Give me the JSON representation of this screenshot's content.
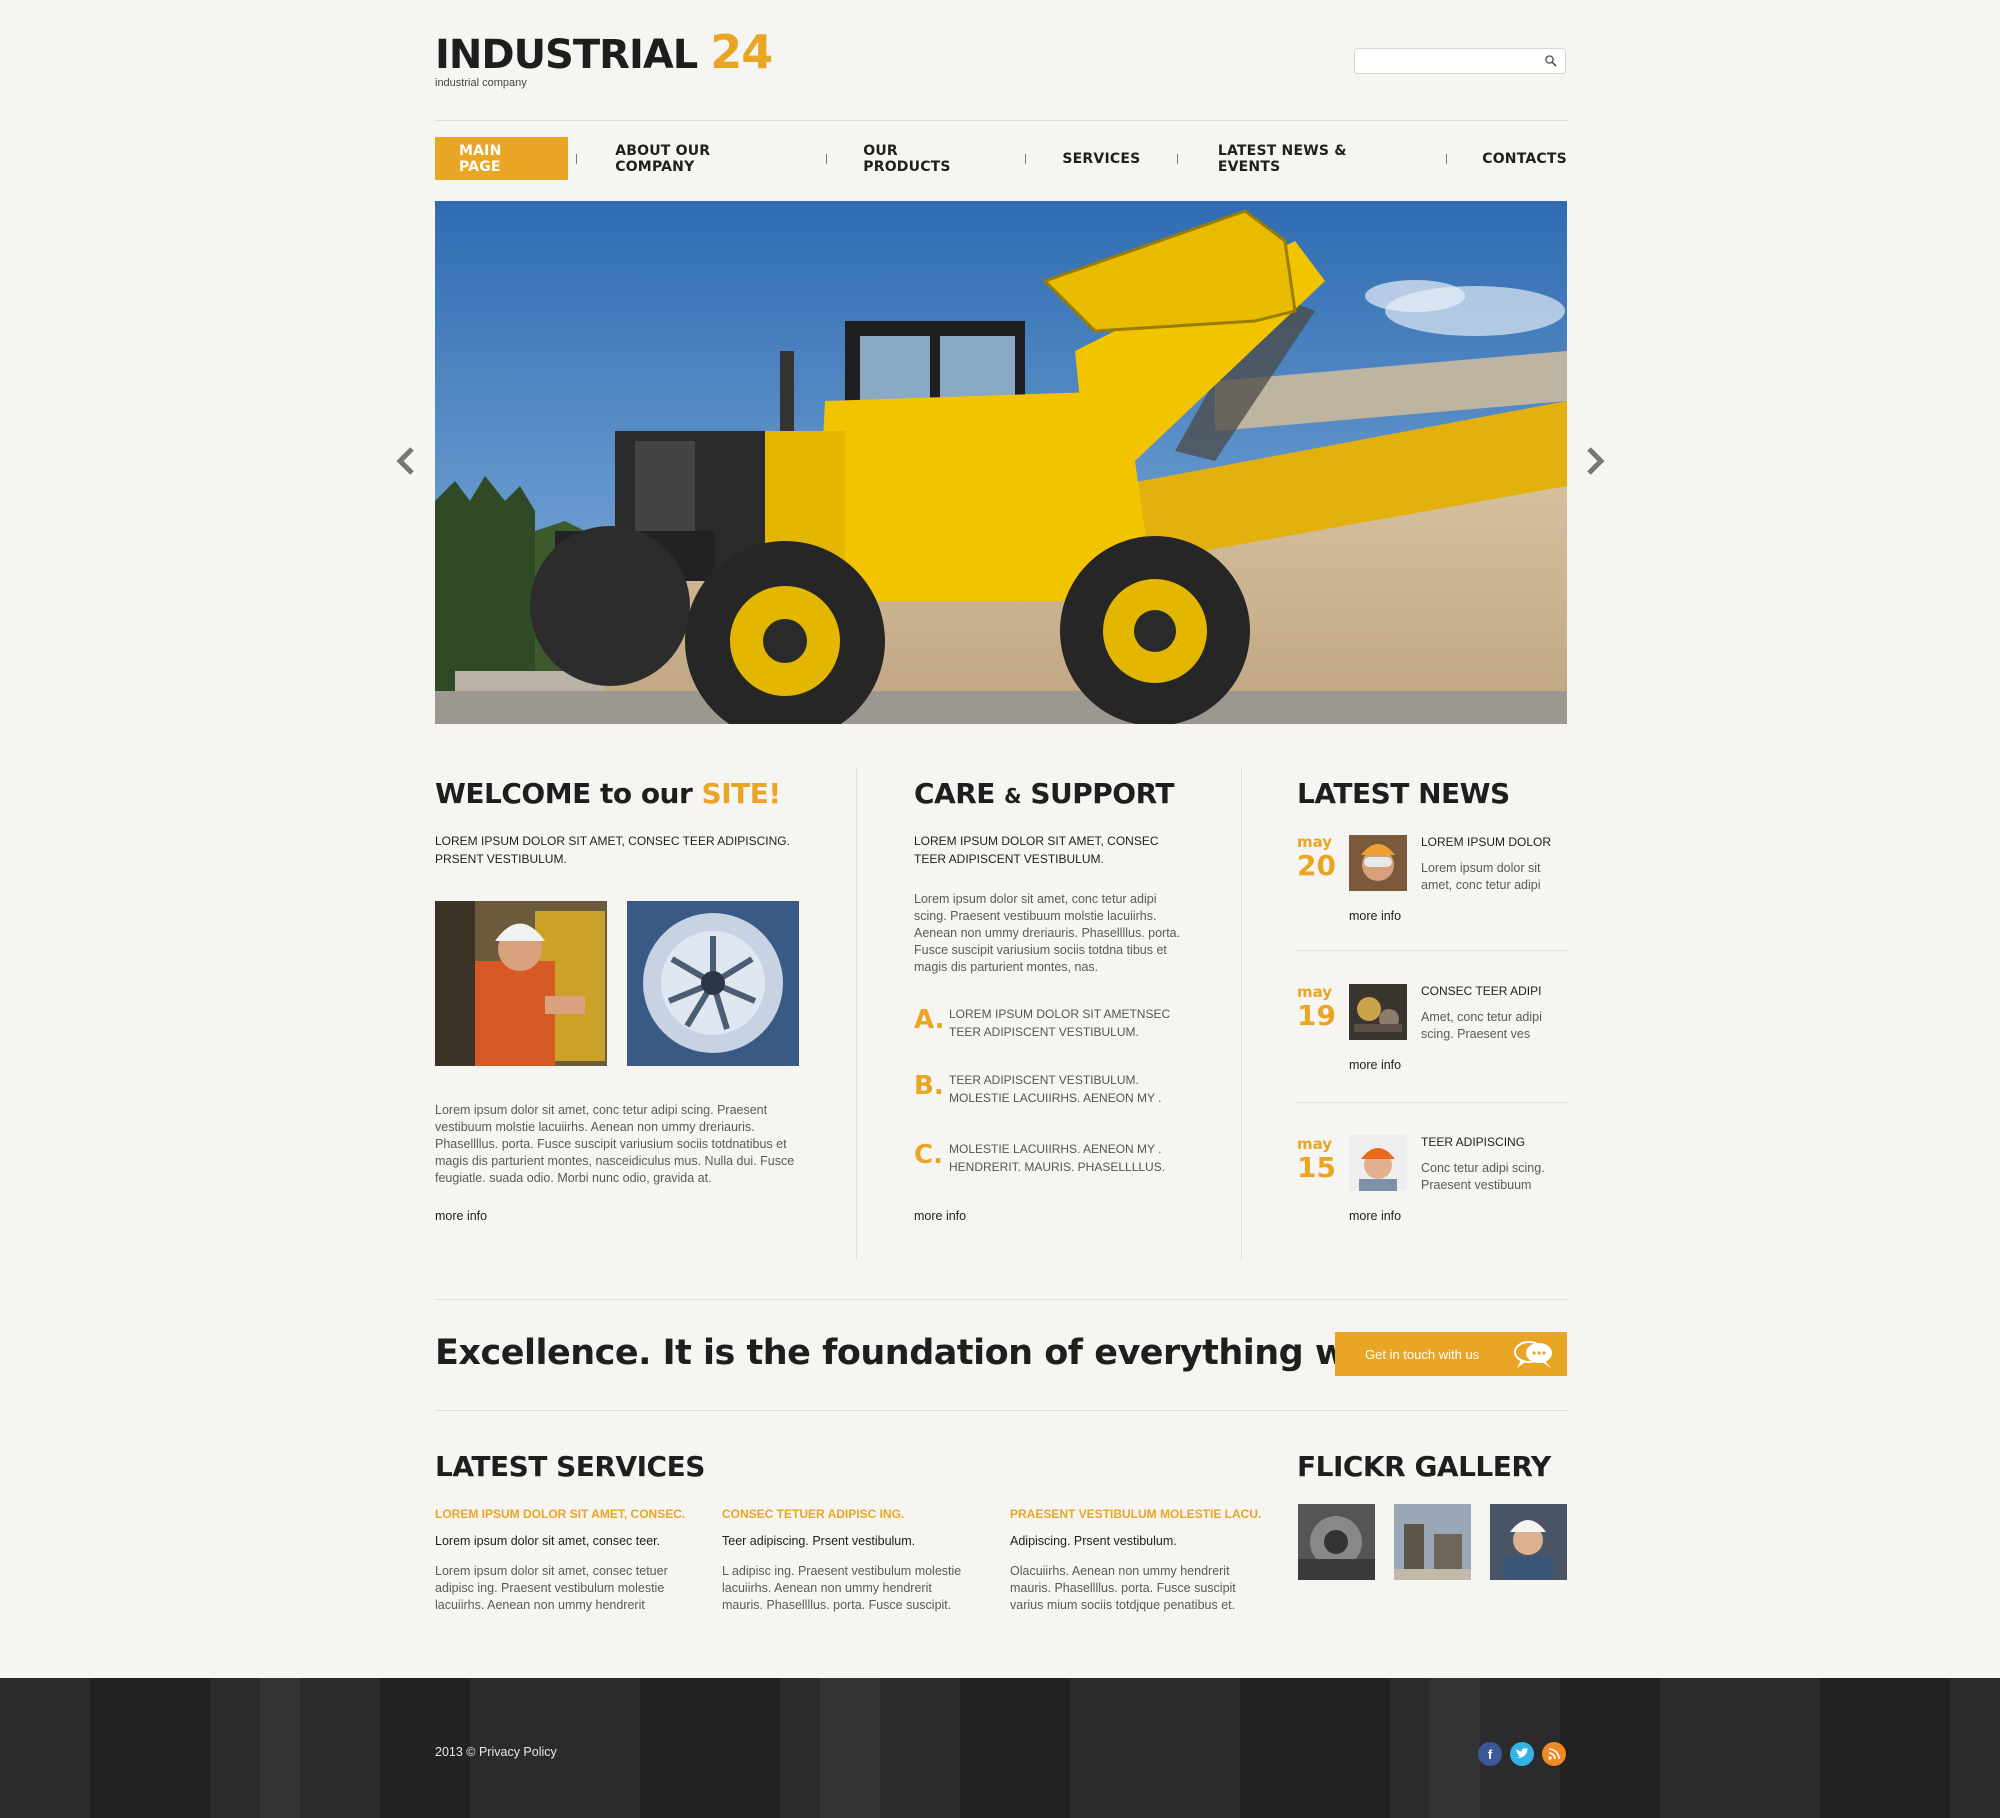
{
  "header": {
    "logo_word": "INDUSTRIAL",
    "logo_number": "24",
    "tagline": "industrial company",
    "search_placeholder": ""
  },
  "nav": [
    {
      "label": "MAIN PAGE",
      "active": true
    },
    {
      "label": "ABOUT OUR COMPANY"
    },
    {
      "label": "OUR PRODUCTS"
    },
    {
      "label": "SERVICES"
    },
    {
      "label": "LATEST NEWS & EVENTS"
    },
    {
      "label": "CONTACTS"
    }
  ],
  "welcome": {
    "title_prefix": "WELCOME to our ",
    "title_accent": "SITE!",
    "intro": "LOREM IPSUM DOLOR SIT AMET, CONSEC TEER ADIPISCING. PRSENT VESTIBULUM.",
    "body": "Lorem ipsum dolor sit amet, conc tetur adipi scing. Praesent vestibuum molstie lacuiirhs. Aenean non ummy dreriauris. Phasellllus. porta. Fusce suscipit variusium sociis totdnatibus et magis dis parturient montes, nasceidiculus mus. Nulla dui. Fusce feugiatle. suada odio. Morbi nunc odio, gravida at.",
    "more": "more info"
  },
  "care": {
    "title_a": "CARE ",
    "title_amp": "&",
    "title_b": " SUPPORT",
    "intro": "LOREM IPSUM DOLOR SIT AMET, CONSEC TEER ADIPISCENT VESTIBULUM.",
    "body": "Lorem ipsum dolor sit amet, conc tetur adipi scing. Praesent vestibuum molstie lacuiirhs. Aenean non ummy dreriauris. Phasellllus. porta. Fusce suscipit variusium sociis totdna tibus et magis dis parturient montes, nas.",
    "list": [
      {
        "letter": "A.",
        "text": "LOREM IPSUM DOLOR SIT AMETNSEC TEER ADIPISCENT VESTIBULUM."
      },
      {
        "letter": "B.",
        "text": "TEER ADIPISCENT VESTIBULUM. MOLESTIE LACUIIRHS. AENEON MY ."
      },
      {
        "letter": "C.",
        "text": "MOLESTIE LACUIIRHS. AENEON MY . HENDRERIT. MAURIS. PHASELLLLUS."
      }
    ],
    "more": "more info"
  },
  "news": {
    "title": "LATEST NEWS",
    "items": [
      {
        "month": "may",
        "day": "20",
        "title": "LOREM IPSUM DOLOR",
        "text": "Lorem ipsum dolor sit amet, conc tetur adipi",
        "more": "more info"
      },
      {
        "month": "may",
        "day": "19",
        "title": "CONSEC TEER ADIPI",
        "text": "Amet, conc tetur adipi scing. Praesent ves",
        "more": "more info"
      },
      {
        "month": "may",
        "day": "15",
        "title": "TEER ADIPISCING",
        "text": "Conc tetur adipi scing. Praesent vestibuum",
        "more": "more info"
      }
    ]
  },
  "excellence": {
    "tagline": "Excellence. It is the foundation of everything we do.",
    "cta": "Get in touch  with us"
  },
  "services": {
    "title": "LATEST SERVICES",
    "items": [
      {
        "title": "LOREM IPSUM DOLOR SIT AMET, CONSEC.",
        "sub": "Lorem ipsum dolor sit amet, consec teer.",
        "text": "Lorem ipsum dolor sit amet, consec tetuer adipisc ing. Praesent vestibulum molestie lacuiirhs. Aenean non ummy hendrerit"
      },
      {
        "title": "CONSEC TETUER ADIPISC ING.",
        "sub": "Teer adipiscing. Prsent vestibulum.",
        "text": "L adipisc ing. Praesent vestibulum molestie lacuiirhs. Aenean non ummy hendrerit mauris. Phasellllus. porta. Fusce suscipit."
      },
      {
        "title": "PRAESENT VESTIBULUM MOLESTIE LACU.",
        "sub": "Adipiscing. Prsent vestibulum.",
        "text": "Olacuiirhs. Aenean non ummy hendrerit mauris. Phasellllus. porta. Fusce suscipit varius mium sociis totdjque penatibus et."
      }
    ]
  },
  "flickr": {
    "title": "FLICKR GALLERY"
  },
  "footer": {
    "copyright": "2013 © Privacy Policy"
  },
  "colors": {
    "accent": "#e9a524",
    "footer_bg": "#2a2a2a",
    "facebook": "#3b5998",
    "twitter": "#33b3e6",
    "rss": "#f08a24"
  }
}
